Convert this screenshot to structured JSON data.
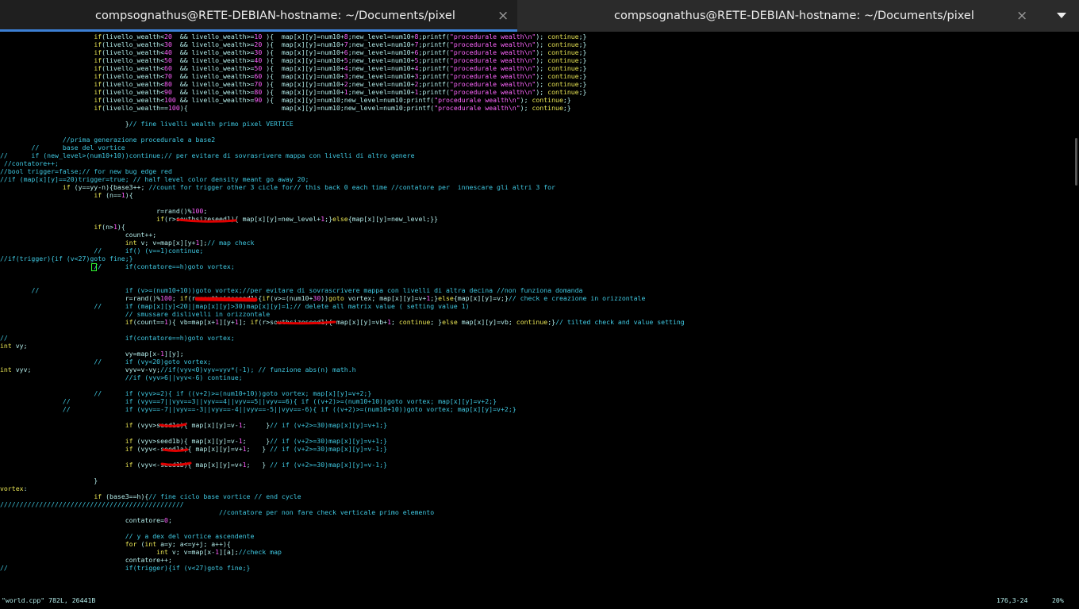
{
  "tabs": [
    {
      "title": "compsognathus@RETE-DEBIAN-hostname: ~/Documents/pixel",
      "active": true
    },
    {
      "title": "compsognathus@RETE-DEBIAN-hostname: ~/Documents/pixel",
      "active": false
    }
  ],
  "tab_close_glyph": "×",
  "icons": {
    "tab_close": "close-icon",
    "tab_menu": "chevron-down-icon"
  },
  "colors": {
    "text": "#b3ecea",
    "keyword": "#e8e454",
    "number": "#ff5fff",
    "comment": "#3fc7e0",
    "annotation": "#e00000",
    "active_tab_underline": "#3c7fd4"
  },
  "editor": {
    "lines": [
      "                        if(livello_wealth<20  && livello_wealth>=10 ){  map[x][y]=num10+8;new_level=num10+8;printf(\"procedurale wealth\\n\"); continue;}",
      "                        if(livello_wealth<30  && livello_wealth>=20 ){  map[x][y]=num10+7;new_level=num10+7;printf(\"procedurale wealth\\n\"); continue;}",
      "                        if(livello_wealth<40  && livello_wealth>=30 ){  map[x][y]=num10+6;new_level=num10+6;printf(\"procedurale wealth\\n\"); continue;}",
      "                        if(livello_wealth<50  && livello_wealth>=40 ){  map[x][y]=num10+5;new_level=num10+5;printf(\"procedurale wealth\\n\"); continue;}",
      "                        if(livello_wealth<60  && livello_wealth>=50 ){  map[x][y]=num10+4;new_level=num10+4;printf(\"procedurale wealth\\n\"); continue;}",
      "                        if(livello_wealth<70  && livello_wealth>=60 ){  map[x][y]=num10+3;new_level=num10+3;printf(\"procedurale wealth\\n\"); continue;}",
      "                        if(livello_wealth<80  && livello_wealth>=70 ){  map[x][y]=num10+2;new_level=num10+2;printf(\"procedurale wealth\\n\"); continue;}",
      "                        if(livello_wealth<90  && livello_wealth>=80 ){  map[x][y]=num10+1;new_level=num10+1;printf(\"procedurale wealth\\n\"); continue;}",
      "                        if(livello_wealth<100 && livello_wealth>=90 ){  map[x][y]=num10;new_level=num10;printf(\"procedurale wealth\\n\"); continue;}",
      "                        if(livello_wealth==100){                        map[x][y]=num10;new_level=num10;printf(\"procedurale wealth\\n\"); continue;}",
      "",
      "                                }// fine livelli wealth primo pixel VERTICE",
      "",
      "                //prima generazione procedurale a base2",
      "        //      base del vortice",
      "//      if (new_level>(num10+10))continue;// per evitare di sovrasrivere mappa con livelli di altro genere",
      " //contatore++;",
      "//bool trigger=false;// for new bug edge red",
      "//if (map[x][y]==20)trigger=true; // half level color density meant go away 20;",
      "                if (y==yy-n){base3++; //count for trigger other 3 cicle for// this back 0 each time //contatore per  innescare gli altri 3 for",
      "                        if (n==1){",
      "",
      "                                        r=rand()%100;",
      "                                        if(r>southsizeseed1){ map[x][y]=new_level+1;}else{map[x][y]=new_level;}}",
      "                        if(n>1){",
      "                                count++;",
      "                                int v; v=map[x][y+1];// map check",
      "                        //      if() (v==1)continue;",
      "//if(trigger){if (v<27)goto fine;}",
      "                        //      if(contatore==h)goto vortex;",
      "",
      "",
      "        //                      if (v>=(num10+10))goto vortex;//per evitare di sovrascrivere mappa con livelli di altra decina //non funziona domanda",
      "                                r=rand()%100; if(r>southsizeseed1){if(v>=(num10+30))goto vortex; map[x][y]=v+1;}else{map[x][y]=v;}// check e creazione in orizzontale",
      "                        //      if (map[x][y]<20||map[x][y]>30)map[x][y]=1;// delete all matrix value ( setting value 1)",
      "                                // smussare dislivelli in orizzontale",
      "                                if(count==1){ vb=map[x+1][y+1]; if(r>southsizeseed1){ map[x][y]=vb+1; continue; }else map[x][y]=vb; continue;}// tilted check and value setting",
      "",
      "//                              if(contatore==h)goto vortex;",
      "int vy;",
      "                                vy=map[x-1][y];",
      "                        //      if (vy<20)goto vortex;",
      "int vyv;                        vyv=v-vy;//if(vyv<0)vyv=vyv*(-1); // funzione abs(n) math.h",
      "                                //if (vyv>6||vyv<-6) continue;",
      "",
      "                        //      if (vyv>=2){ if ((v+2)>=(num10+10))goto vortex; map[x][y]=v+2;}",
      "                //              if (vyv==7||vyv==3||vyv==4||vyv==5||vyv==6){ if ((v+2)>=(num10+10))goto vortex; map[x][y]=v+2;}",
      "                //              if (vyv==-7||vyv==-3||vyv==-4||vyv==-5||vyv==-6){ if ((v+2)>=(num10+10))goto vortex; map[x][y]=v+2;}",
      "",
      "                                if (vyv>seed1a){ map[x][y]=v-1;     }// if (v+2>=30)map[x][y]=v+1;}",
      "",
      "                                if (vyv>seed1b){ map[x][y]=v-1;     }// if (v+2>=30)map[x][y]=v+1;}",
      "                                if (vyv<-seed1a){ map[x][y]=v+1;   } // if (v+2>=30)map[x][y]=v-1;}",
      "",
      "                                if (vyv<-seed1b){ map[x][y]=v+1;   } // if (v+2>=30)map[x][y]=v-1;}",
      "",
      "                        }",
      "vortex:",
      "                        if (base3==h){// fine ciclo base vortice // end cycle",
      "///////////////////////////////////////////////",
      "                                                        //contatore per non fare check verticale primo elemento",
      "                                contatore=0;",
      "",
      "                                // y a dex del vortice ascendente",
      "                                for (int a=y; a<=y+j; a++){",
      "                                        int v; v=map[x-1][a];//check map",
      "                                contatore++;",
      "//                              if(trigger){if (v<27)goto fine;}"
    ]
  },
  "status": {
    "file": "\"world.cpp\" 782L, 26441B",
    "position": "176,3-24",
    "percent": "20%"
  },
  "scroll": {
    "position_fraction": 0.2
  }
}
